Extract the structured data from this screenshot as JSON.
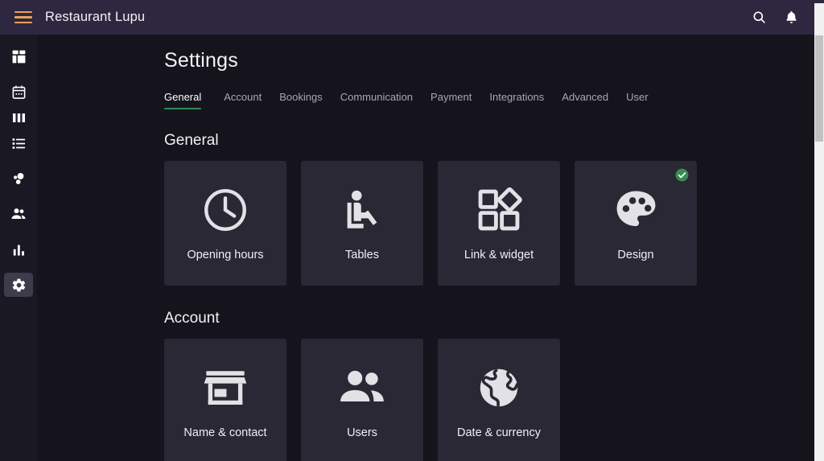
{
  "header": {
    "menu_icon": "hamburger-icon",
    "title": "Restaurant Lupu",
    "search_icon": "search-icon",
    "notifications_icon": "bell-icon",
    "background_color": "#2e2740",
    "menu_color": "#e8a25c"
  },
  "sidebar": {
    "background_color": "#1a1823",
    "active_background_color": "#3e3c4b",
    "items": [
      {
        "name": "dashboard",
        "icon": "dashboard-grid-icon",
        "active": false
      },
      {
        "name": "calendar",
        "icon": "calendar-icon",
        "active": false
      },
      {
        "name": "columns",
        "icon": "columns-icon",
        "active": false
      },
      {
        "name": "list",
        "icon": "list-icon",
        "active": false
      },
      {
        "name": "bubbles",
        "icon": "bubble-chart-icon",
        "active": false
      },
      {
        "name": "guests",
        "icon": "people-icon",
        "active": false
      },
      {
        "name": "statistics",
        "icon": "bar-chart-icon",
        "active": false
      },
      {
        "name": "settings",
        "icon": "gear-icon",
        "active": true
      }
    ]
  },
  "main": {
    "page_title": "Settings",
    "tabs": [
      {
        "label": "General",
        "active": true
      },
      {
        "label": "Account",
        "active": false
      },
      {
        "label": "Bookings",
        "active": false
      },
      {
        "label": "Communication",
        "active": false
      },
      {
        "label": "Payment",
        "active": false
      },
      {
        "label": "Integrations",
        "active": false
      },
      {
        "label": "Advanced",
        "active": false
      },
      {
        "label": "User",
        "active": false
      }
    ],
    "active_tab_underline_color": "#2e8b57",
    "sections": [
      {
        "title": "General",
        "cards": [
          {
            "label": "Opening hours",
            "icon": "clock-icon",
            "badge": null
          },
          {
            "label": "Tables",
            "icon": "seat-icon",
            "badge": null
          },
          {
            "label": "Link & widget",
            "icon": "widgets-icon",
            "badge": null
          },
          {
            "label": "Design",
            "icon": "palette-icon",
            "badge": "check-circle-icon"
          }
        ]
      },
      {
        "title": "Account",
        "cards": [
          {
            "label": "Name & contact",
            "icon": "store-icon",
            "badge": null
          },
          {
            "label": "Users",
            "icon": "people-icon",
            "badge": null
          },
          {
            "label": "Date & currency",
            "icon": "globe-icon",
            "badge": null
          }
        ]
      }
    ],
    "badge_color": "#3a8a52",
    "card_background_color": "#2a2834",
    "content_background_color": "#15141c"
  },
  "scrollbar": {
    "track_color": "#f1f1f1",
    "thumb_color": "#c1c1c1"
  }
}
